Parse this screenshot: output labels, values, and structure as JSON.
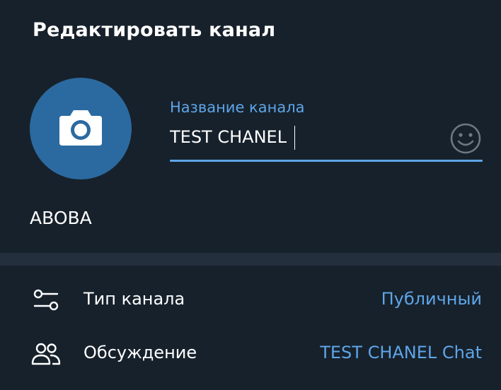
{
  "dialog": {
    "title": "Редактировать канал"
  },
  "avatar": {
    "icon": "camera-icon",
    "caption": "ABOBA",
    "color": "#2b6aa0"
  },
  "name_field": {
    "label": "Название канала",
    "value": "TEST CHANEL",
    "emoji_icon": "smile-icon"
  },
  "settings": [
    {
      "icon": "sliders-icon",
      "label": "Тип канала",
      "value": "Публичный"
    },
    {
      "icon": "people-icon",
      "label": "Обсуждение",
      "value": "TEST CHANEL Chat"
    }
  ],
  "colors": {
    "background": "#17212b",
    "separator": "#232f3c",
    "accent": "#5ea5e8",
    "text": "#ffffff"
  }
}
